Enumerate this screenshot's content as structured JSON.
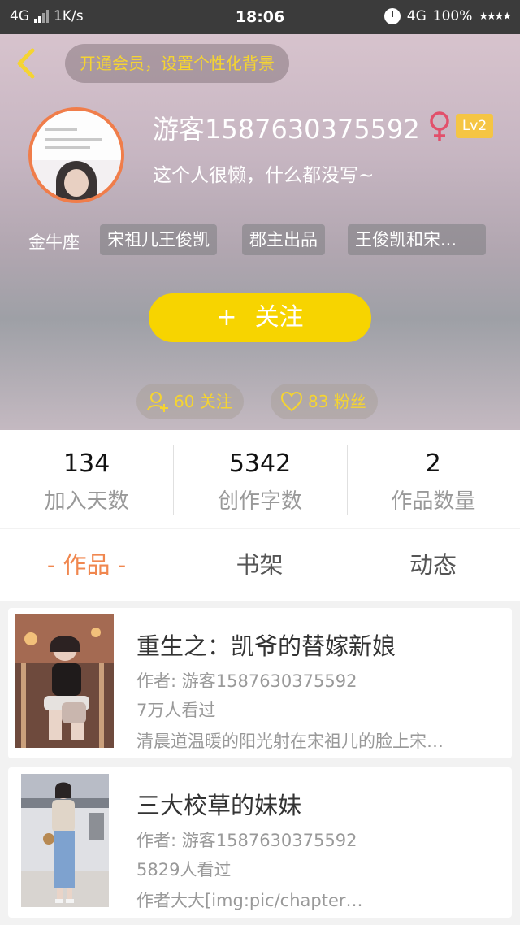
{
  "status_bar": {
    "network": "4G",
    "speed": "1K/s",
    "time": "18:06",
    "network_right": "4G",
    "battery": "100%",
    "stars": "★★★★"
  },
  "header": {
    "vip_prompt": "开通会员，设置个性化背景",
    "username": "游客1587630375592",
    "gender_symbol": "♀",
    "level": "Lv2",
    "bio": "这个人很懒，什么都没写~",
    "zodiac": "金牛座",
    "tags": [
      "宋祖儿王俊凯",
      "郡主出品",
      "王俊凯和宋..."
    ],
    "follow_plus": "+",
    "follow_label": "关注",
    "following": "60 关注",
    "fans": "83 粉丝",
    "colors": {
      "accent_yellow": "#f7d400",
      "avatar_ring": "#f07d4a",
      "level_badge": "#f5c543",
      "female": "#e2506b"
    }
  },
  "counts": [
    {
      "value": "134",
      "label": "加入天数"
    },
    {
      "value": "5342",
      "label": "创作字数"
    },
    {
      "value": "2",
      "label": "作品数量"
    }
  ],
  "tabs": {
    "works": "- 作品 -",
    "bookshelf": "书架",
    "activity": "动态",
    "active_color": "#f0874f"
  },
  "works": [
    {
      "title": "重生之：凯爷的替嫁新娘",
      "author": "作者: 游客1587630375592",
      "views": "7万人看过",
      "excerpt": "清晨道温暖的阳光射在宋祖儿的脸上宋…"
    },
    {
      "title": "三大校草的妹妹",
      "author": "作者: 游客1587630375592",
      "views": "5829人看过",
      "excerpt": "作者大大[img:pic/chapter…"
    }
  ]
}
